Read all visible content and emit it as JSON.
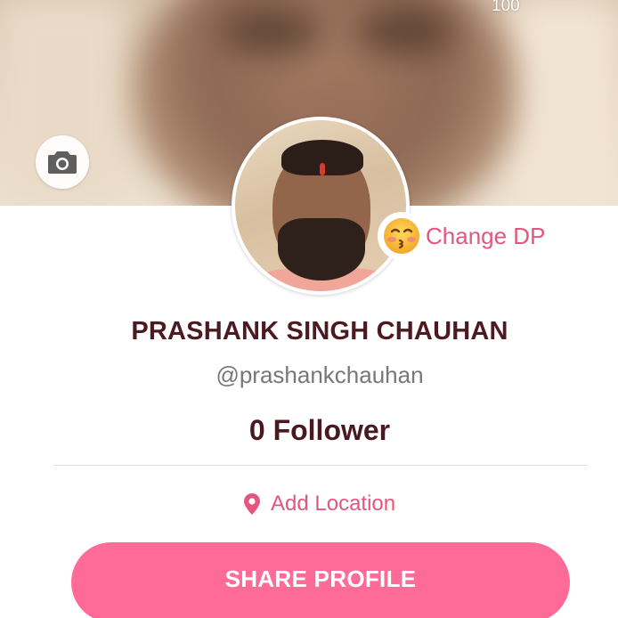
{
  "cover": {
    "counter": "100"
  },
  "profile": {
    "change_dp_label": "Change DP",
    "name": "PRASHANK SINGH CHAUHAN",
    "handle": "@prashankchauhan",
    "followers": "0 Follower",
    "add_location_label": "Add Location",
    "share_button_label": "SHARE PROFILE"
  },
  "icons": {
    "camera": "camera-icon",
    "emoji": "kissing-face-emoji-icon",
    "location": "location-pin-icon"
  },
  "colors": {
    "accent_pink": "#e4567d",
    "button_pink": "#ff6b98",
    "name_text": "#4d1a22"
  }
}
